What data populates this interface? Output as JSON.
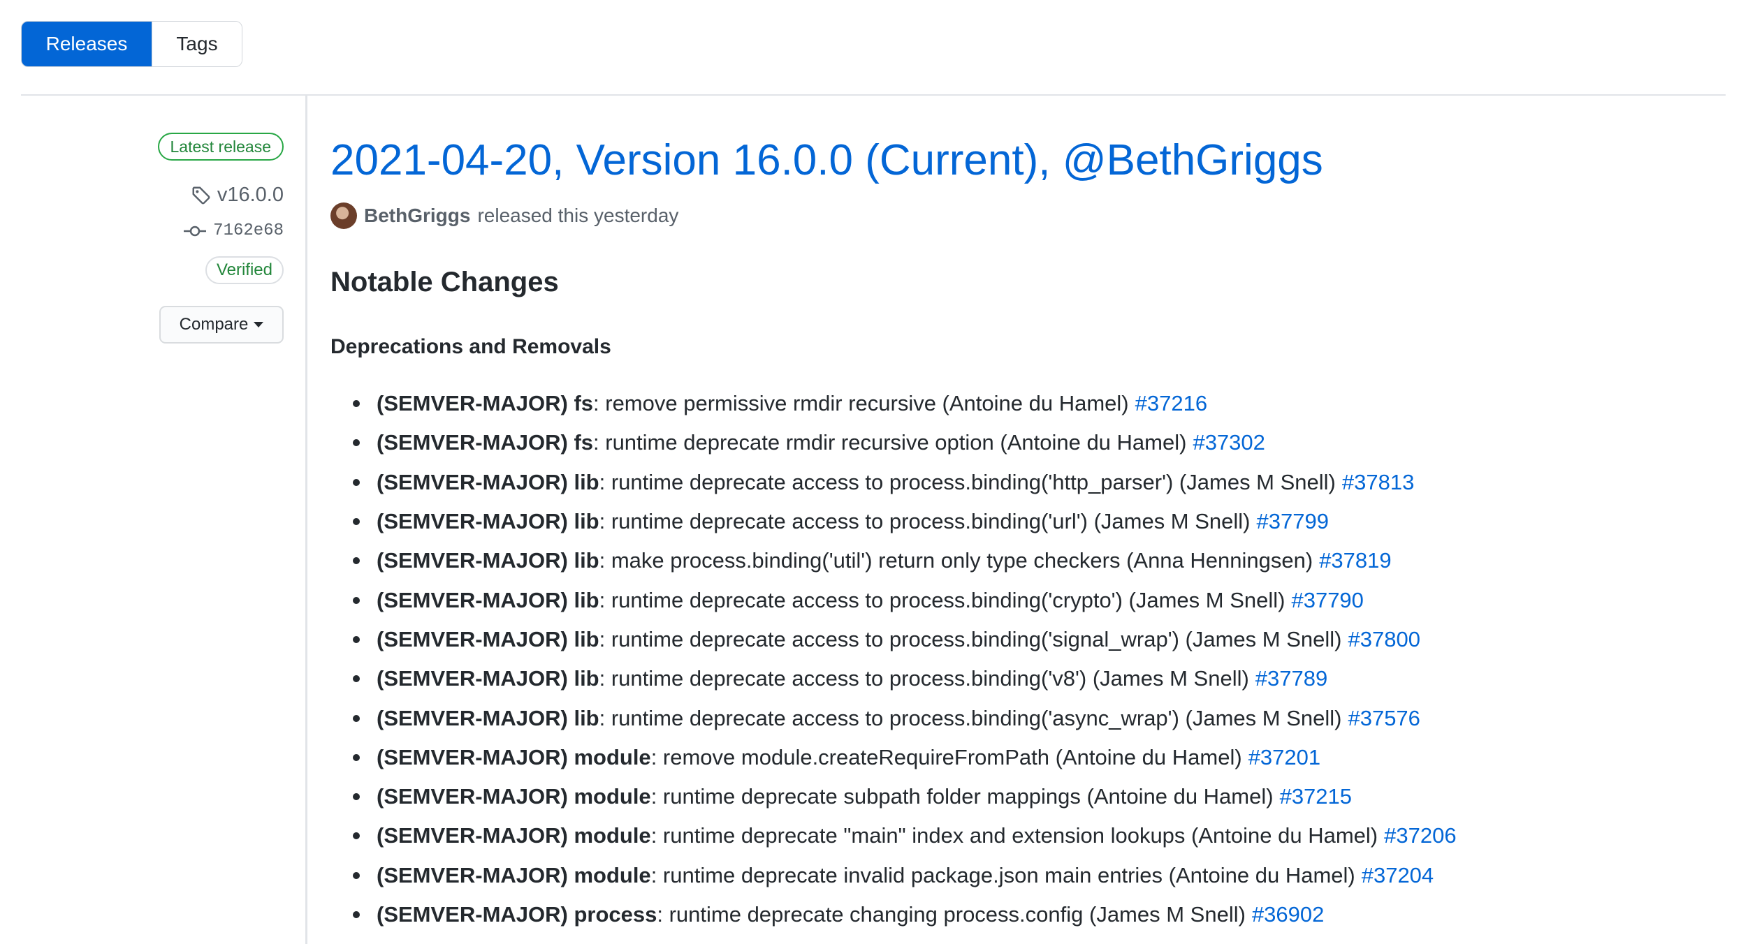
{
  "tabs": [
    {
      "label": "Releases",
      "active": true
    },
    {
      "label": "Tags",
      "active": false
    }
  ],
  "sidebar": {
    "latest_badge": "Latest release",
    "tag": "v16.0.0",
    "commit": "7162e68",
    "verified": "Verified",
    "compare_label": "Compare"
  },
  "release": {
    "title": "2021-04-20, Version 16.0.0 (Current), @BethGriggs",
    "author": "BethGriggs",
    "released_text": "released this yesterday",
    "section_title": "Notable Changes",
    "subsection_title": "Deprecations and Removals",
    "changes": [
      {
        "bold": "(SEMVER-MAJOR) fs",
        "text": ": remove permissive rmdir recursive (Antoine du Hamel)",
        "pr": "#37216"
      },
      {
        "bold": "(SEMVER-MAJOR) fs",
        "text": ": runtime deprecate rmdir recursive option (Antoine du Hamel)",
        "pr": "#37302"
      },
      {
        "bold": "(SEMVER-MAJOR) lib",
        "text": ": runtime deprecate access to process.binding('http_parser') (James M Snell)",
        "pr": "#37813"
      },
      {
        "bold": "(SEMVER-MAJOR) lib",
        "text": ": runtime deprecate access to process.binding('url') (James M Snell)",
        "pr": "#37799"
      },
      {
        "bold": "(SEMVER-MAJOR) lib",
        "text": ": make process.binding('util') return only type checkers (Anna Henningsen)",
        "pr": "#37819"
      },
      {
        "bold": "(SEMVER-MAJOR) lib",
        "text": ": runtime deprecate access to process.binding('crypto') (James M Snell)",
        "pr": "#37790"
      },
      {
        "bold": "(SEMVER-MAJOR) lib",
        "text": ": runtime deprecate access to process.binding('signal_wrap') (James M Snell)",
        "pr": "#37800"
      },
      {
        "bold": "(SEMVER-MAJOR) lib",
        "text": ": runtime deprecate access to process.binding('v8') (James M Snell)",
        "pr": "#37789"
      },
      {
        "bold": "(SEMVER-MAJOR) lib",
        "text": ": runtime deprecate access to process.binding('async_wrap') (James M Snell)",
        "pr": "#37576"
      },
      {
        "bold": "(SEMVER-MAJOR) module",
        "text": ": remove module.createRequireFromPath (Antoine du Hamel)",
        "pr": "#37201"
      },
      {
        "bold": "(SEMVER-MAJOR) module",
        "text": ": runtime deprecate subpath folder mappings (Antoine du Hamel)",
        "pr": "#37215"
      },
      {
        "bold": "(SEMVER-MAJOR) module",
        "text": ": runtime deprecate \"main\" index and extension lookups (Antoine du Hamel)",
        "pr": "#37206"
      },
      {
        "bold": "(SEMVER-MAJOR) module",
        "text": ": runtime deprecate invalid package.json main entries (Antoine du Hamel)",
        "pr": "#37204"
      },
      {
        "bold": "(SEMVER-MAJOR) process",
        "text": ": runtime deprecate changing process.config (James M Snell)",
        "pr": "#36902"
      }
    ]
  },
  "colors": {
    "accent": "#0366d6",
    "success": "#22863a",
    "text": "#24292e",
    "muted": "#586069"
  }
}
